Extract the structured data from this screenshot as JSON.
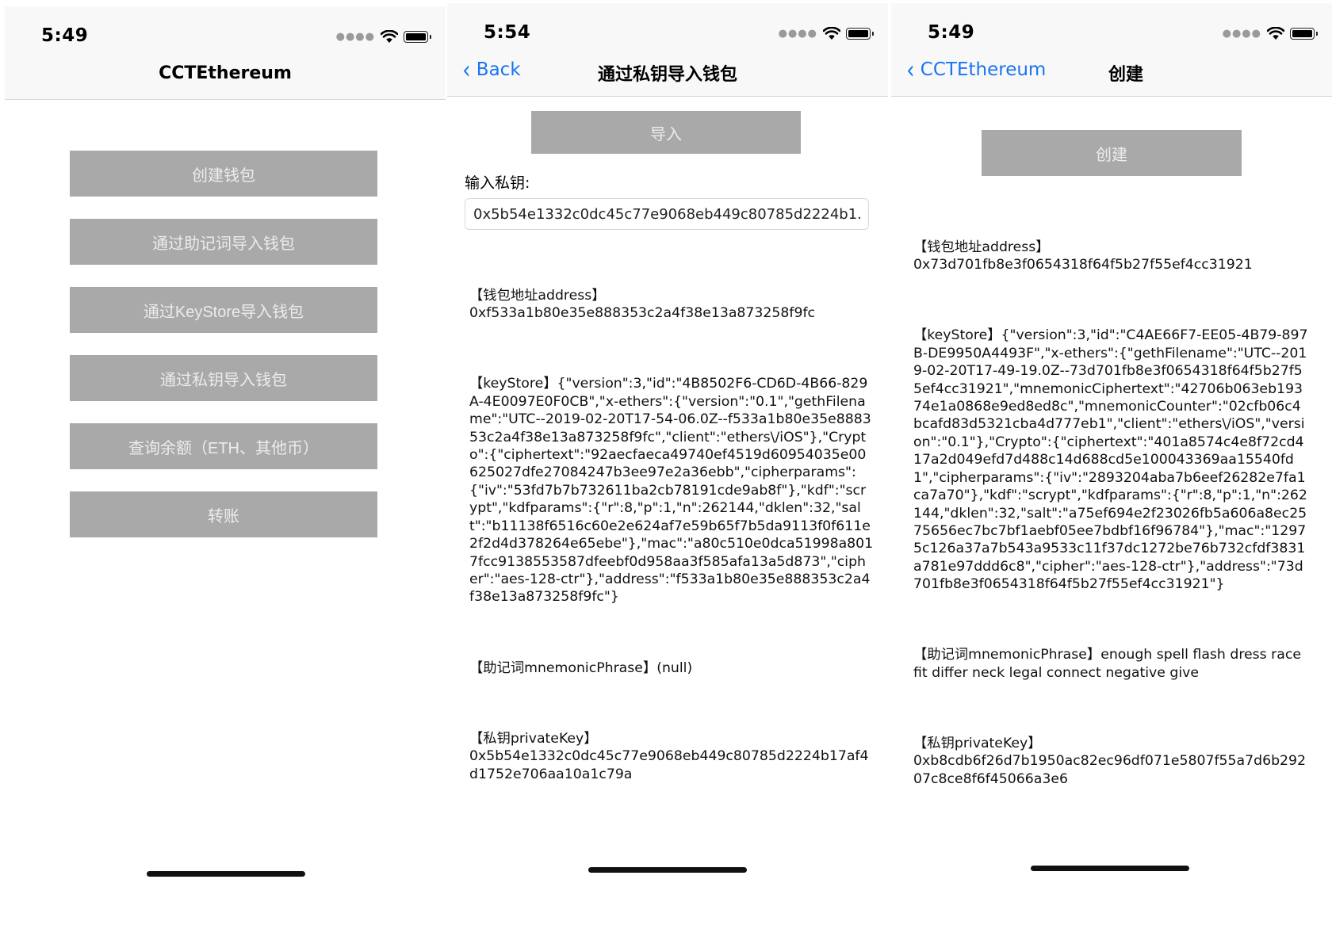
{
  "screen1": {
    "time": "5:49",
    "title": "CCTEthereum",
    "buttons": [
      "创建钱包",
      "通过助记词导入钱包",
      "通过KeyStore导入钱包",
      "通过私钥导入钱包",
      "查询余额（ETH、其他币）",
      "转账"
    ]
  },
  "screen2": {
    "time": "5:54",
    "back_label": "Back",
    "title": "通过私钥导入钱包",
    "import_button": "导入",
    "input_label": "输入私钥:",
    "private_key_value": "0x5b54e1332c0dc45c77e9068eb449c80785d2224b1...",
    "address_label": "【钱包地址address】",
    "address": "0xf533a1b80e35e888353c2a4f38e13a873258f9fc",
    "keystore_label": "【keyStore】",
    "keystore": "{\"version\":3,\"id\":\"4B8502F6-CD6D-4B66-829A-4E0097E0F0CB\",\"x-ethers\":{\"version\":\"0.1\",\"gethFilename\":\"UTC--2019-02-20T17-54-06.0Z--f533a1b80e35e888353c2a4f38e13a873258f9fc\",\"client\":\"ethers\\/iOS\"},\"Crypto\":{\"ciphertext\":\"92aecfaeca49740ef4519d60954035e00625027dfe27084247b3ee97e2a36ebb\",\"cipherparams\":{\"iv\":\"53fd7b7b732611ba2cb78191cde9ab8f\"},\"kdf\":\"scrypt\",\"kdfparams\":{\"r\":8,\"p\":1,\"n\":262144,\"dklen\":32,\"salt\":\"b11138f6516c60e2e624af7e59b65f7b5da9113f0f611e2f2d4d378264e65ebe\"},\"mac\":\"a80c510e0dca51998a8017fcc9138553587dfeebf0d958aa3f585afa13a5d873\",\"cipher\":\"aes-128-ctr\"},\"address\":\"f533a1b80e35e888353c2a4f38e13a873258f9fc\"}",
    "mnemonic_label": "【助记词mnemonicPhrase】",
    "mnemonic": "(null)",
    "privatekey_label": "【私钥privateKey】",
    "privatekey": "0x5b54e1332c0dc45c77e9068eb449c80785d2224b17af4d1752e706aa10a1c79a"
  },
  "screen3": {
    "time": "5:49",
    "back_label": "CCTEthereum",
    "title": "创建",
    "create_button": "创建",
    "address_label": "【钱包地址address】",
    "address": "0x73d701fb8e3f0654318f64f5b27f55ef4cc31921",
    "keystore_label": "【keyStore】",
    "keystore": "{\"version\":3,\"id\":\"C4AE66F7-EE05-4B79-897B-DE9950A4493F\",\"x-ethers\":{\"gethFilename\":\"UTC--2019-02-20T17-49-19.0Z--73d701fb8e3f0654318f64f5b27f55ef4cc31921\",\"mnemonicCiphertext\":\"42706b063eb19374e1a0868e9ed8ed8c\",\"mnemonicCounter\":\"02cfb06c4bcafd83d5321cba4d777eb1\",\"client\":\"ethers\\/iOS\",\"version\":\"0.1\"},\"Crypto\":{\"ciphertext\":\"401a8574c4e8f72cd417a2d049efd7d488c14d688cd5e100043369aa15540fd1\",\"cipherparams\":{\"iv\":\"2893204aba7b6eef26282e7fa1ca7a70\"},\"kdf\":\"scrypt\",\"kdfparams\":{\"r\":8,\"p\":1,\"n\":262144,\"dklen\":32,\"salt\":\"a75ef694e2f23026fb5a606a8ec2575656ec7bc7bf1aebf05ee7bdbf16f96784\"},\"mac\":\"12975c126a37a7b543a9533c11f37dc1272be76b732cfdf3831a781e97ddd6c8\",\"cipher\":\"aes-128-ctr\"},\"address\":\"73d701fb8e3f0654318f64f5b27f55ef4cc31921\"}",
    "mnemonic_label": "【助记词mnemonicPhrase】",
    "mnemonic": "enough spell flash dress race fit differ neck legal connect negative give",
    "privatekey_label": "【私钥privateKey】",
    "privatekey": "0xb8cdb6f26d7b1950ac82ec96df071e5807f55a7d6b29207c8ce8f6f45066a3e6"
  }
}
